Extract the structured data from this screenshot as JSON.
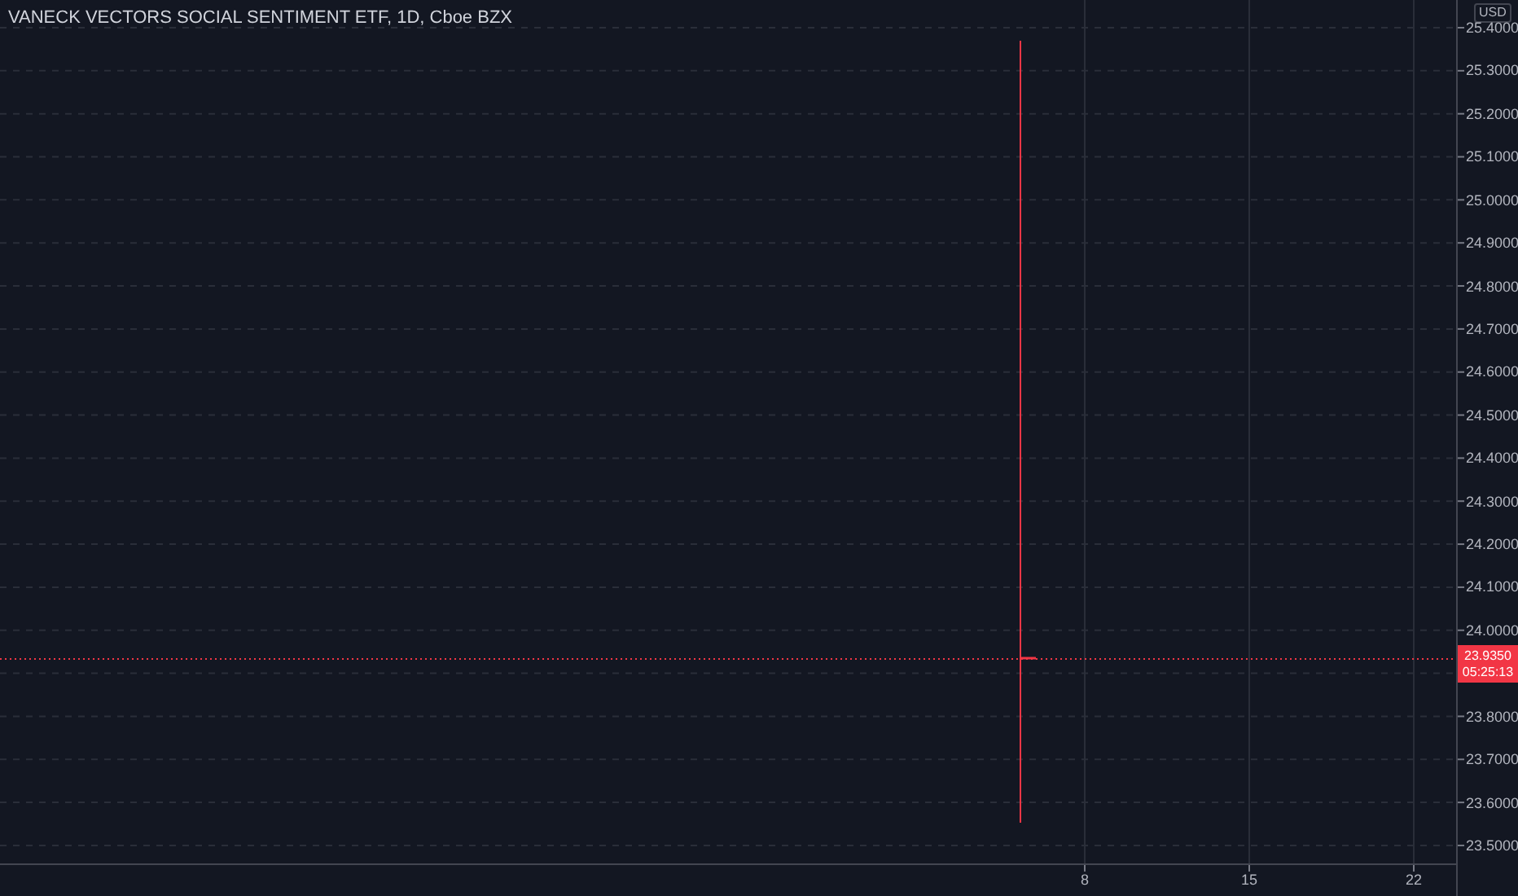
{
  "legend": {
    "title": "VANECK VECTORS SOCIAL SENTIMENT ETF, 1D, Cboe BZX"
  },
  "price_axis": {
    "currency": "USD",
    "labels": [
      "25.4000",
      "25.3000",
      "25.2000",
      "25.1000",
      "25.0000",
      "24.9000",
      "24.8000",
      "24.7000",
      "24.6000",
      "24.5000",
      "24.4000",
      "24.3000",
      "24.2000",
      "24.1000",
      "24.0000"
    ],
    "labels_below_badge": [
      "23.8000",
      "23.7000",
      "23.6000",
      "23.5000"
    ]
  },
  "time_axis": {
    "labels": [
      "8",
      "15",
      "22"
    ]
  },
  "last_price": {
    "price": "23.9350",
    "countdown": "05:25:13"
  }
}
